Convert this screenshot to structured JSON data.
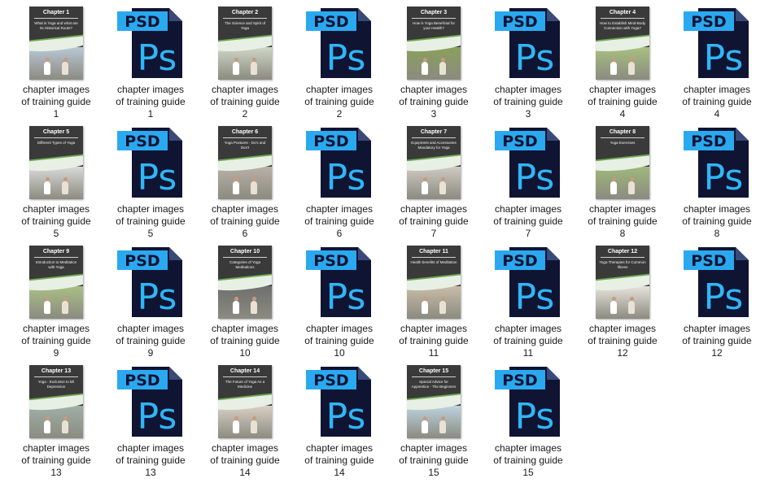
{
  "colors": {
    "psd_badge": "#2aa9f0",
    "psd_body": "#0f1433",
    "ps_letters": "#2fb6f7",
    "cover_bg": "#3a3a3a",
    "cover_accent": "#6aa84f"
  },
  "psd_icon": {
    "badge": "PSD",
    "mark": "Ps"
  },
  "label_line1": "chapter images",
  "label_line2": "of training guide",
  "items": [
    {
      "type": "cover",
      "num": "1",
      "chapter": "Chapter 1",
      "title": "What is Yoga and what are its Historical Roots?",
      "photo": "#b9c7d6"
    },
    {
      "type": "psd",
      "num": "1"
    },
    {
      "type": "cover",
      "num": "2",
      "chapter": "Chapter 2",
      "title": "The Science and Spirit of Yoga",
      "photo": "#cfd7c7"
    },
    {
      "type": "psd",
      "num": "2"
    },
    {
      "type": "cover",
      "num": "3",
      "chapter": "Chapter 3",
      "title": "How is Yoga Beneficial for your Health?",
      "photo": "#8aa05a"
    },
    {
      "type": "psd",
      "num": "3"
    },
    {
      "type": "cover",
      "num": "4",
      "chapter": "Chapter 4",
      "title": "How to Establish Mind-Body Connection with Yoga?",
      "photo": "#a8c080"
    },
    {
      "type": "psd",
      "num": "4"
    },
    {
      "type": "cover",
      "num": "5",
      "chapter": "Chapter 5",
      "title": "Different Types of Yoga",
      "photo": "#d9d9d9"
    },
    {
      "type": "psd",
      "num": "5"
    },
    {
      "type": "cover",
      "num": "6",
      "chapter": "Chapter 6",
      "title": "Yoga Postures - Do's and Don't",
      "photo": "#b8b0a8"
    },
    {
      "type": "psd",
      "num": "6"
    },
    {
      "type": "cover",
      "num": "7",
      "chapter": "Chapter 7",
      "title": "Equipment and Accessories Mandatory for Yoga",
      "photo": "#cfcac2"
    },
    {
      "type": "psd",
      "num": "7"
    },
    {
      "type": "cover",
      "num": "8",
      "chapter": "Chapter 8",
      "title": "Yoga Exercises",
      "photo": "#9fb87a"
    },
    {
      "type": "psd",
      "num": "8"
    },
    {
      "type": "cover",
      "num": "9",
      "chapter": "Chapter 9",
      "title": "Introduction to Meditation with Yoga",
      "photo": "#a9bf85"
    },
    {
      "type": "psd",
      "num": "9"
    },
    {
      "type": "cover",
      "num": "10",
      "chapter": "Chapter 10",
      "title": "Categories of Yoga Meditations",
      "photo": "#6f6f6f"
    },
    {
      "type": "psd",
      "num": "10"
    },
    {
      "type": "cover",
      "num": "11",
      "chapter": "Chapter 11",
      "title": "Health benefits of Meditation",
      "photo": "#c9bca8"
    },
    {
      "type": "psd",
      "num": "11"
    },
    {
      "type": "cover",
      "num": "12",
      "chapter": "Chapter 12",
      "title": "Yoga Therapies for Common Illness",
      "photo": "#e6e3dc"
    },
    {
      "type": "psd",
      "num": "12"
    },
    {
      "type": "cover",
      "num": "13",
      "chapter": "Chapter 13",
      "title": "Yoga - Exclusive to kill Depression",
      "photo": "#9fb0a6"
    },
    {
      "type": "psd",
      "num": "13"
    },
    {
      "type": "cover",
      "num": "14",
      "chapter": "Chapter 14",
      "title": "The Future of Yoga As a Medicine",
      "photo": "#d8d0c4"
    },
    {
      "type": "psd",
      "num": "14"
    },
    {
      "type": "cover",
      "num": "15",
      "chapter": "Chapter 15",
      "title": "Special Advice for Apprentice - The Beginners",
      "photo": "#bcd3df"
    },
    {
      "type": "psd",
      "num": "15"
    }
  ]
}
